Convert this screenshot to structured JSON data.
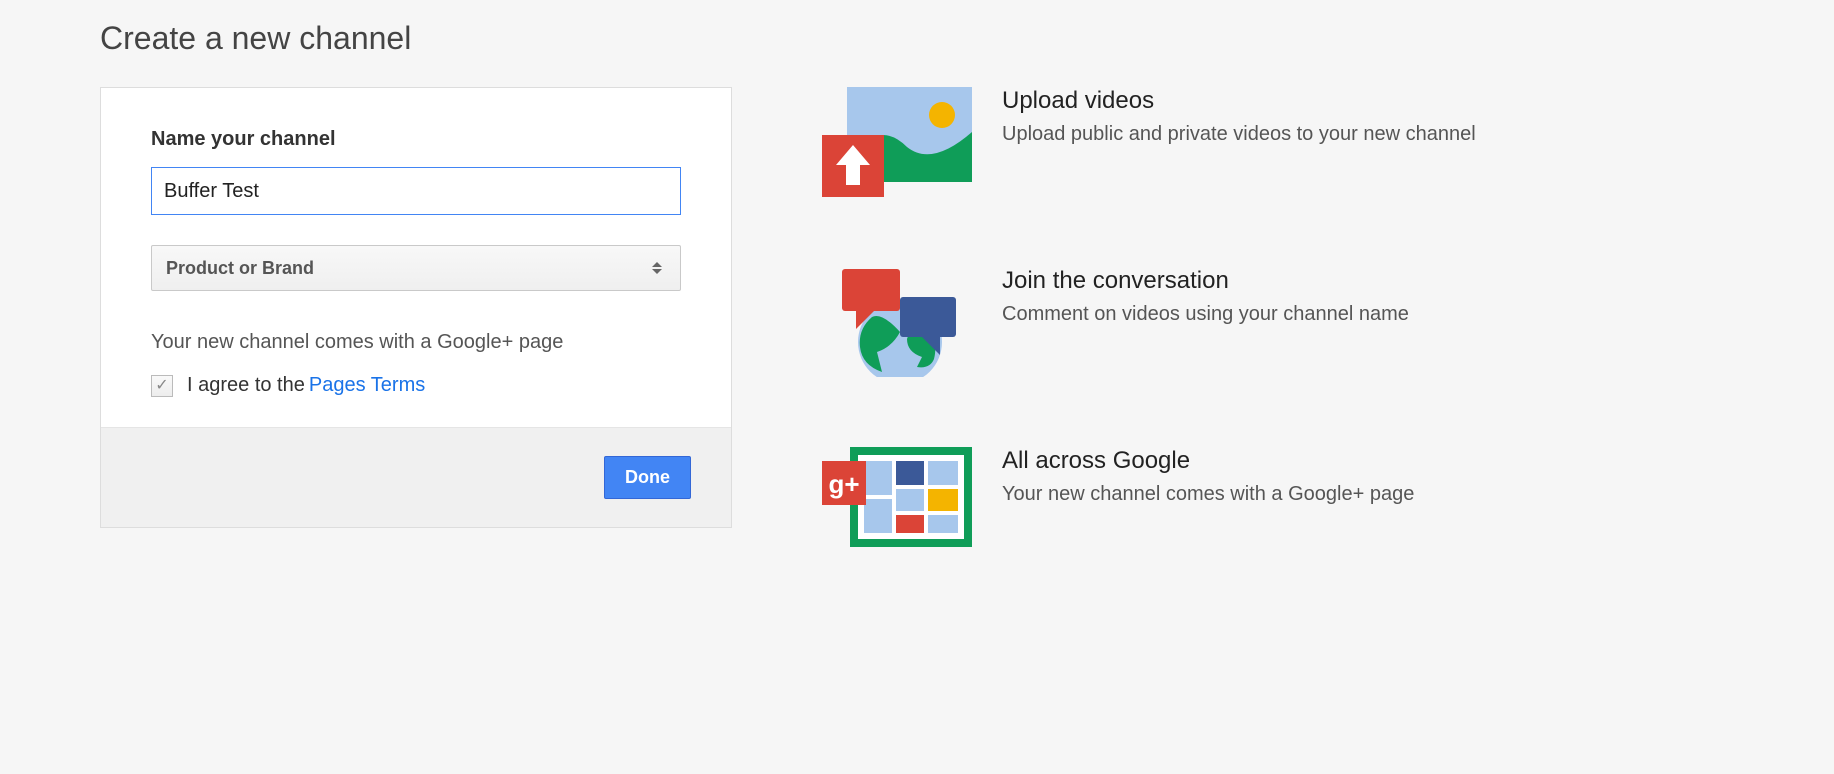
{
  "title": "Create a new channel",
  "form": {
    "name_label": "Name your channel",
    "name_value": "Buffer Test",
    "category_selected": "Product or Brand",
    "info_text": "Your new channel comes with a Google+ page",
    "agree_prefix": "I agree to the ",
    "agree_link": "Pages Terms",
    "agree_checked": true,
    "done_label": "Done"
  },
  "features": [
    {
      "icon": "upload-photo-icon",
      "title": "Upload videos",
      "desc": "Upload public and private videos to your new channel"
    },
    {
      "icon": "conversation-icon",
      "title": "Join the conversation",
      "desc": "Comment on videos using your channel name"
    },
    {
      "icon": "gplus-grid-icon",
      "title": "All across Google",
      "desc": "Your new channel comes with a Google+ page"
    }
  ]
}
